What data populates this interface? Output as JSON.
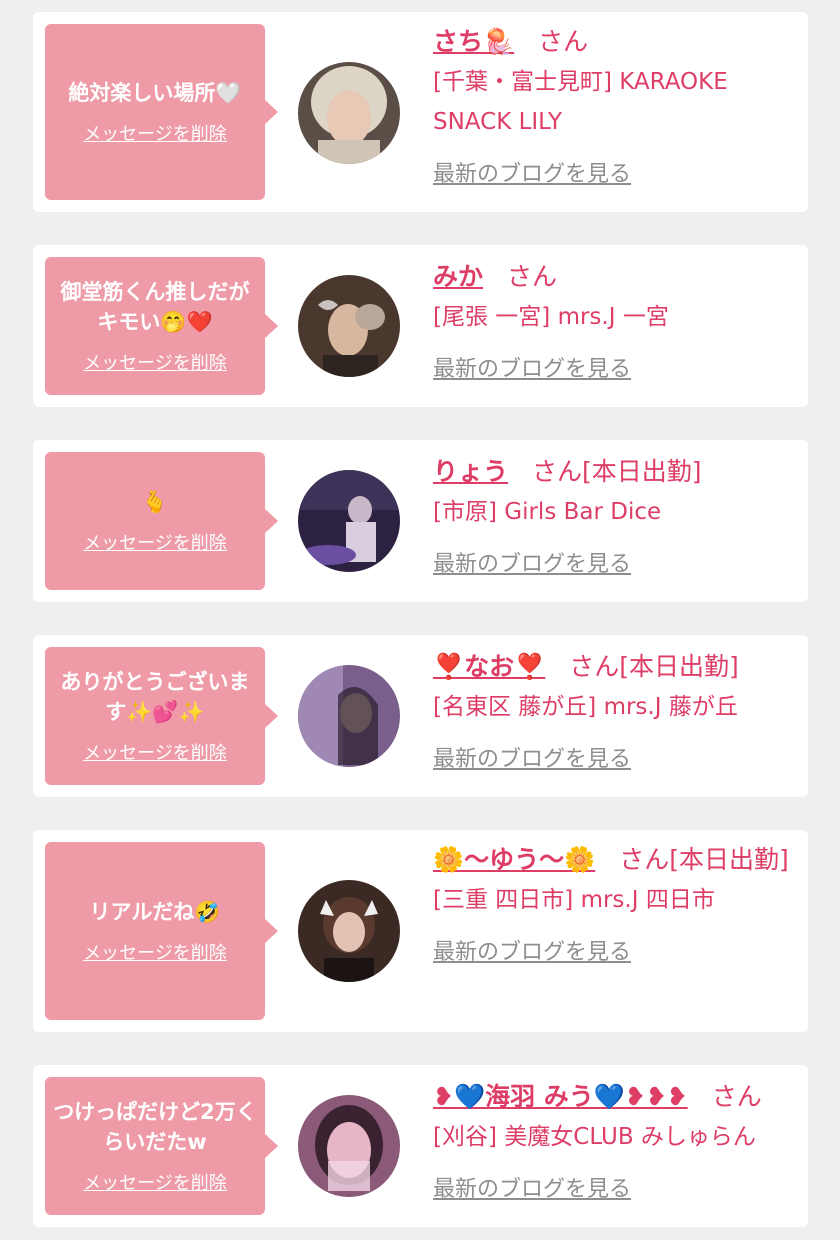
{
  "colors": {
    "accent": "#de3d66",
    "bubble": "#ee9ba7",
    "link_gray": "#8e8e8e"
  },
  "cards": [
    {
      "message": "絶対楽しい場所🤍",
      "delete_label": "メッセージを削除",
      "name": "さち🪼",
      "suffix": "さん",
      "shop": "[千葉・富士見町] KARAOKE SNACK LILY",
      "blog_link": "最新のブログを見る"
    },
    {
      "message": "御堂筋くん推しだがキモい🤭❤️",
      "delete_label": "メッセージを削除",
      "name": "みか",
      "suffix": "さん",
      "shop": "[尾張 一宮] mrs.J 一宮",
      "blog_link": "最新のブログを見る"
    },
    {
      "message": "🫰",
      "delete_label": "メッセージを削除",
      "name": "りょう",
      "suffix": "さん[本日出勤]",
      "shop": "[市原] Girls Bar Dice",
      "blog_link": "最新のブログを見る"
    },
    {
      "message": "ありがとうございます✨💕✨",
      "delete_label": "メッセージを削除",
      "name": "❣️なお❣️",
      "suffix": "さん[本日出勤]",
      "shop": "[名東区 藤が丘] mrs.J 藤が丘",
      "blog_link": "最新のブログを見る"
    },
    {
      "message": "リアルだね🤣",
      "delete_label": "メッセージを削除",
      "name": "🌼〜ゆう〜🌼",
      "suffix": "さん[本日出勤]",
      "shop": "[三重 四日市] mrs.J 四日市",
      "blog_link": "最新のブログを見る"
    },
    {
      "message": "つけっぱだけど2万くらいだたw",
      "delete_label": "メッセージを削除",
      "name": "❥💙海羽 みう💙❥❥❥",
      "suffix": "さん",
      "shop": "[刈谷] 美魔女CLUB みしゅらん",
      "blog_link": "最新のブログを見る"
    }
  ]
}
